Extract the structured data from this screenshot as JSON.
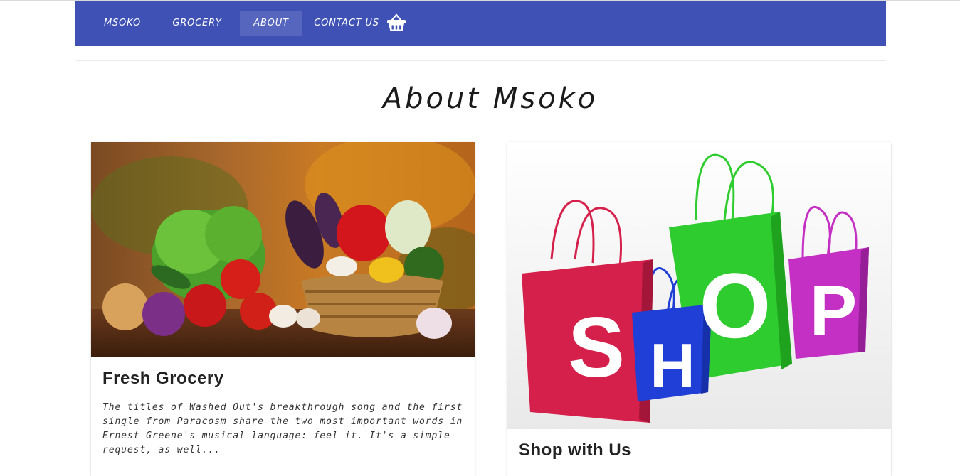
{
  "nav": {
    "items": [
      {
        "label": "MSOKO"
      },
      {
        "label": "GROCERY"
      },
      {
        "label": "ABOUT"
      },
      {
        "label": "CONTACT US"
      }
    ],
    "active": "ABOUT",
    "cart_icon": "basket-icon"
  },
  "page": {
    "title": "About Msoko"
  },
  "cards": [
    {
      "image": "vegetable-basket-photo",
      "title": "Fresh Grocery",
      "text": "The titles of Washed Out's breakthrough song and the first single from Paracosm share the two most important words in Ernest Greene's musical language: feel it. It's a simple request, as well..."
    },
    {
      "image": "shop-bags-photo",
      "title": "Shop with Us",
      "bag_letters": [
        "S",
        "H",
        "O",
        "P"
      ]
    }
  ],
  "colors": {
    "navbar": "#3f51b5",
    "bag_red": "#d4204a",
    "bag_blue": "#1f3fd6",
    "bag_green": "#2ecc2e",
    "bag_magenta": "#c42fc4"
  }
}
